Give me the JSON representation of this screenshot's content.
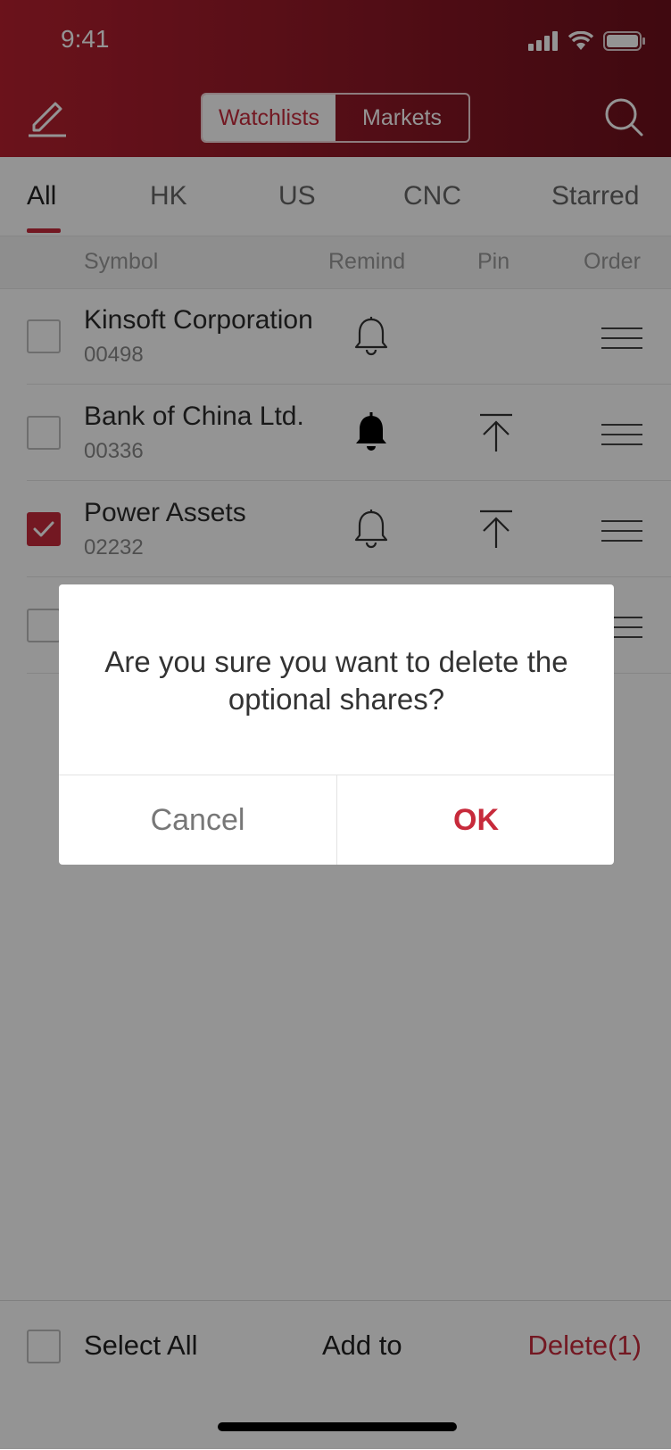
{
  "status": {
    "time": "9:41"
  },
  "header": {
    "segments": [
      "Watchlists",
      "Markets"
    ],
    "active_segment": "Watchlists",
    "accent": "#c72a3b"
  },
  "tabs": [
    "All",
    "HK",
    "US",
    "CNC",
    "Starred"
  ],
  "active_tab": "All",
  "columns": {
    "symbol": "Symbol",
    "remind": "Remind",
    "pin": "Pin",
    "order": "Order"
  },
  "rows": [
    {
      "name": "Kinsoft Corporation",
      "code": "00498",
      "checked": false,
      "remind": "outline",
      "pin": false
    },
    {
      "name": "Bank of China Ltd.",
      "code": "00336",
      "checked": false,
      "remind": "filled",
      "pin": true
    },
    {
      "name": "Power Assets",
      "code": "02232",
      "checked": true,
      "remind": "outline",
      "pin": true
    }
  ],
  "bottom": {
    "select_all": "Select All",
    "add_to": "Add to",
    "delete": "Delete(1)"
  },
  "dialog": {
    "message": "Are you sure you want to delete the optional shares?",
    "cancel": "Cancel",
    "ok": "OK"
  },
  "icons": [
    "edit-icon",
    "search-icon",
    "bell-icon",
    "pin-top-icon",
    "drag-handle-icon",
    "check-icon"
  ]
}
